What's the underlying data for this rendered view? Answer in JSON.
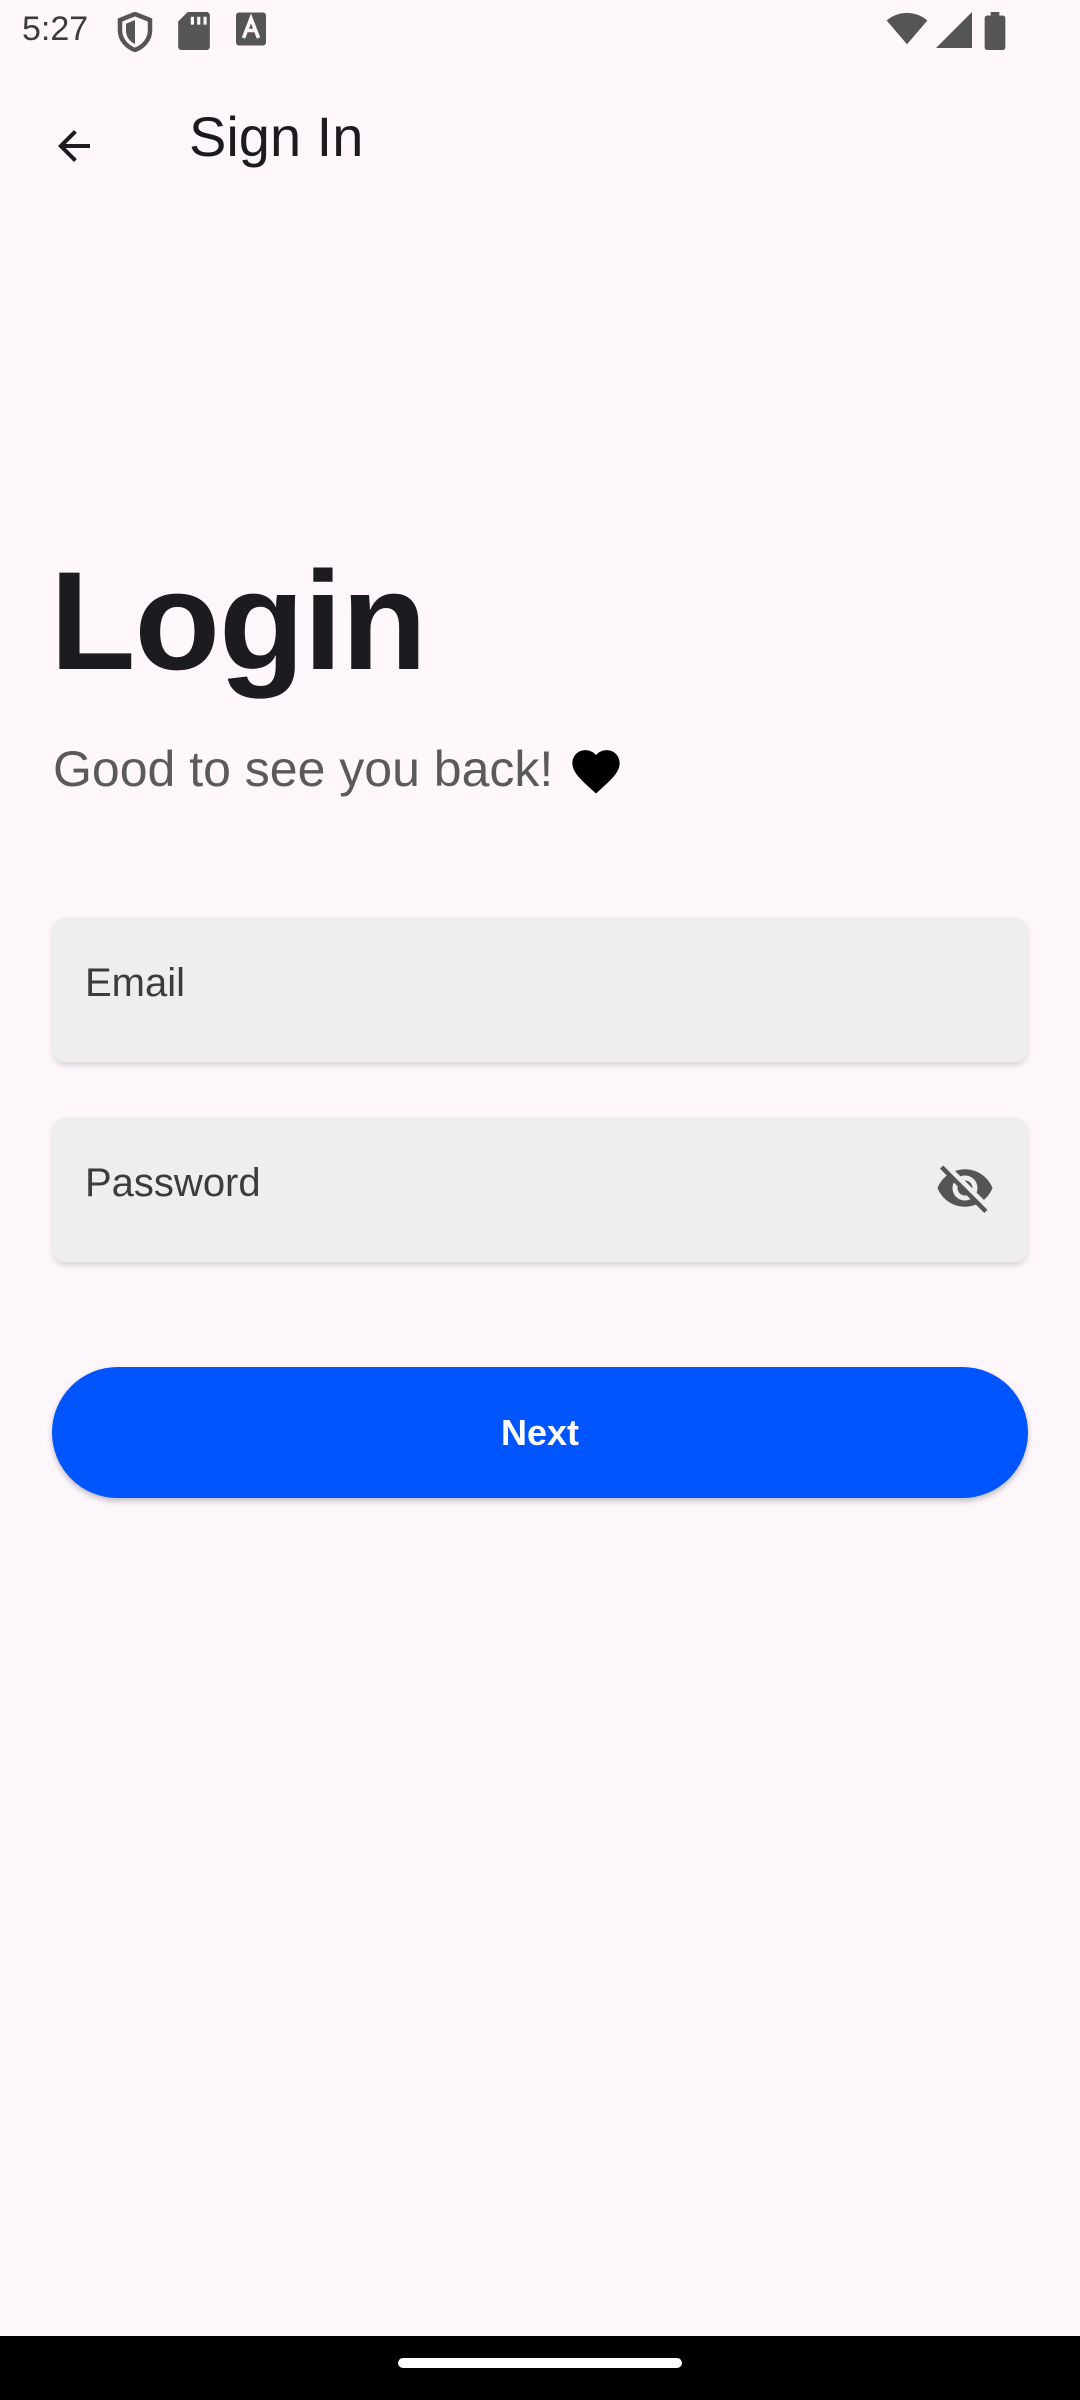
{
  "status_bar": {
    "time": "5:27",
    "icons": [
      "shield-icon",
      "sd-card-icon",
      "font-a-icon",
      "wifi-icon",
      "signal-icon",
      "battery-icon"
    ]
  },
  "app_bar": {
    "title": "Sign In",
    "back_icon": "arrow-back-icon"
  },
  "main": {
    "heading": "Login",
    "subtitle": "Good to see you back!",
    "subtitle_icon": "heart-icon"
  },
  "form": {
    "email_label": "Email",
    "password_label": "Password",
    "visibility_icon": "visibility-off-icon",
    "next_label": "Next"
  },
  "colors": {
    "background": "#fdf7fc",
    "primary_button": "#0055ff",
    "field_background": "#eeeeee"
  }
}
